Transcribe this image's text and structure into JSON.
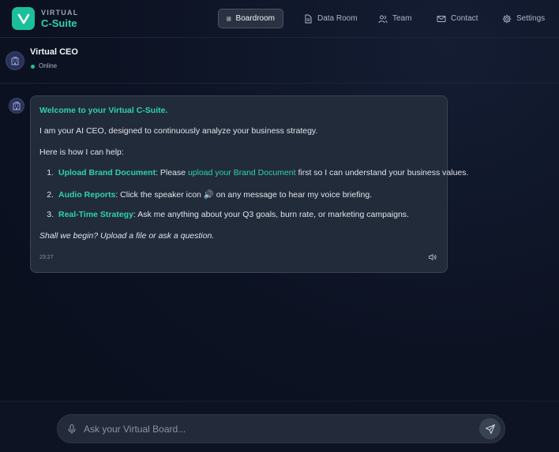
{
  "brand": {
    "sub": "VIRTUAL",
    "main": "C-Suite",
    "logo_letter": "V",
    "accent": "#1bbf9b"
  },
  "nav": [
    {
      "label": "Boardroom",
      "icon": "grid-icon",
      "active": true
    },
    {
      "label": "Data Room",
      "icon": "document-icon",
      "active": false
    },
    {
      "label": "Team",
      "icon": "users-icon",
      "active": false
    },
    {
      "label": "Contact",
      "icon": "mail-icon",
      "active": false
    },
    {
      "label": "Settings",
      "icon": "gear-icon",
      "active": false
    }
  ],
  "chat_header": {
    "name": "Virtual CEO",
    "status": "Online",
    "status_color": "#22c58e"
  },
  "message": {
    "welcome": "Welcome to your Virtual C-Suite.",
    "intro": "I am your AI CEO, designed to continuously analyze your business strategy.",
    "help": "Here is how I can help:",
    "items": [
      {
        "num": "1.",
        "title": "Upload Brand Document",
        "pre": ": Please ",
        "link": "upload your Brand Document",
        "post": " first so I can understand your business values."
      },
      {
        "num": "2.",
        "title": "Audio Reports",
        "pre": ": Click the speaker icon ",
        "emoji": "🔊",
        "post": " on any message to hear my voice briefing."
      },
      {
        "num": "3.",
        "title": "Real-Time Strategy",
        "pre": ": Ask me anything about your Q3 goals, burn rate, or marketing campaigns."
      }
    ],
    "closing": "Shall we begin? Upload a file or ask a question.",
    "timestamp": "23:27"
  },
  "composer": {
    "placeholder": "Ask your Virtual Board..."
  }
}
